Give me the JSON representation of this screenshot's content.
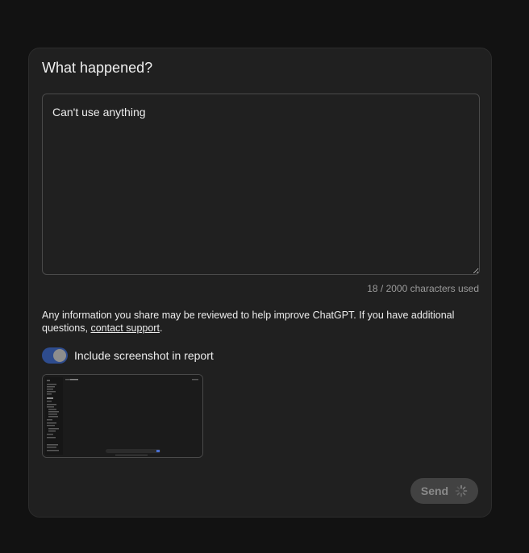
{
  "dialog": {
    "title": "What happened?",
    "textarea_value": "Can't use anything",
    "char_count": "18 / 2000 characters used",
    "disclaimer_text": "Any information you share may be reviewed to help improve ChatGPT. If you have additional questions, ",
    "contact_link": "contact support",
    "disclaimer_end": ".",
    "screenshot_toggle": {
      "label": "Include screenshot in report",
      "checked": true
    },
    "send_label": "Send"
  },
  "colors": {
    "background": "#121212",
    "dialog_bg": "#202020",
    "toggle_on": "#2e4c8e",
    "button_disabled": "#424242"
  }
}
